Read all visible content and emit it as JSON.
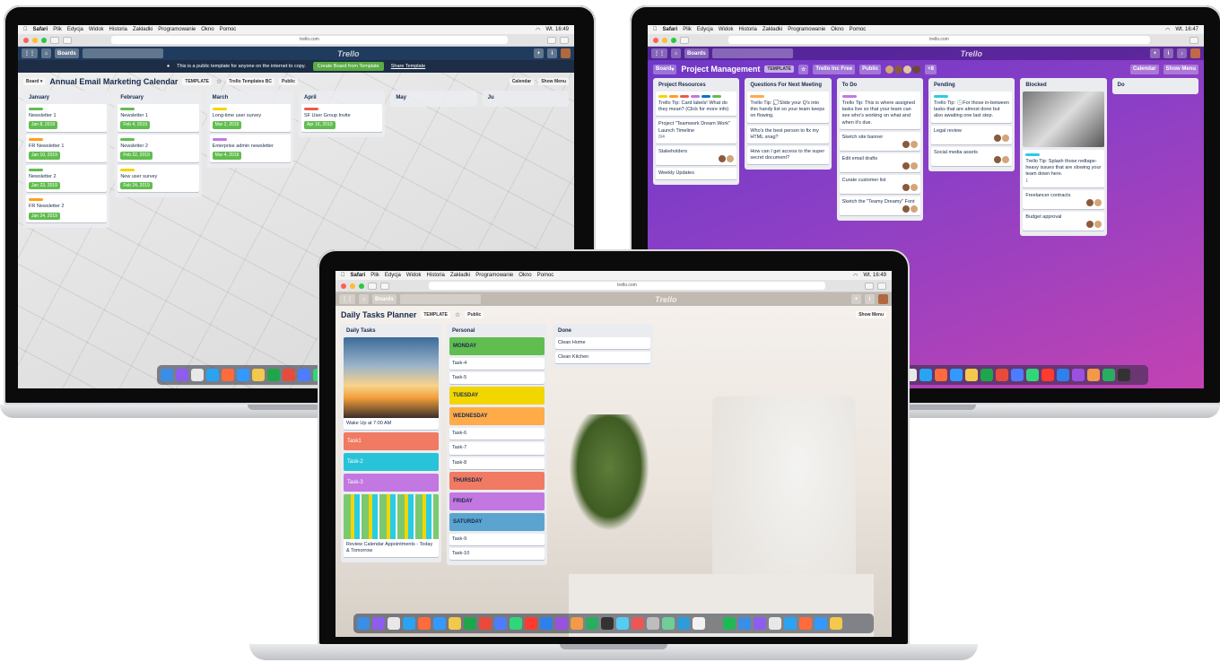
{
  "menubar": {
    "app": "Safari",
    "items": [
      "Plik",
      "Edycja",
      "Widok",
      "Historia",
      "Zakładki",
      "Programowanie",
      "Okno",
      "Pomoc"
    ],
    "time_left": "Wt. 16:49",
    "time_right": "Wt. 16:47",
    "time_mid": "Wt. 16:49"
  },
  "url": "trello.com",
  "boards_label": "Boards",
  "logo": "Trello",
  "left": {
    "public_notice": "This is a public template for anyone on the internet to copy.",
    "create_btn": "Create Board from Template",
    "share_link": "Share Template",
    "board_btn": "Board",
    "title": "Annual Email Marketing Calendar",
    "template_badge": "TEMPLATE",
    "team": "Trello Templates",
    "team_badge": "BC",
    "visibility": "Public",
    "calendar": "Calendar",
    "show_menu": "Show Menu",
    "lists": [
      {
        "name": "January",
        "cards": [
          {
            "t": "Newsletter 1",
            "d": "Jan 8, 2019",
            "c": "#61bd4f"
          },
          {
            "t": "FR Newsletter 1",
            "d": "Jan 10, 2019",
            "c": "#ff9f1a"
          },
          {
            "t": "Newsletter 2",
            "d": "Jan 23, 2019",
            "c": "#61bd4f"
          },
          {
            "t": "FR Newsletter 2",
            "d": "Jan 24, 2019",
            "c": "#ff9f1a"
          }
        ]
      },
      {
        "name": "February",
        "cards": [
          {
            "t": "Newsletter 1",
            "d": "Feb 4, 2019",
            "c": "#61bd4f"
          },
          {
            "t": "Newsletter 2",
            "d": "Feb 22, 2019",
            "c": "#61bd4f"
          },
          {
            "t": "New user survey",
            "d": "Feb 24, 2019",
            "c": "#f2d600"
          }
        ]
      },
      {
        "name": "March",
        "cards": [
          {
            "t": "Long-time user survey",
            "d": "Mar 2, 2019",
            "c": "#f2d600"
          },
          {
            "t": "Enterprise admin newsletter",
            "d": "Mar 4, 2019",
            "c": "#c377e0"
          }
        ]
      },
      {
        "name": "April",
        "cards": [
          {
            "t": "SF User Group Invite",
            "d": "Apr 16, 2019",
            "c": "#eb5a46"
          }
        ]
      },
      {
        "name": "May",
        "cards": []
      },
      {
        "name": "Ju",
        "cards": []
      }
    ]
  },
  "right": {
    "board_btn": "Board",
    "title": "Project Management",
    "template_badge": "TEMPLATE",
    "team": "Trello Inc",
    "team_badge": "Free",
    "visibility": "Public",
    "member_count": "+8",
    "calendar": "Calendar",
    "show_menu": "Show Menu",
    "lists": [
      {
        "name": "Project Resources",
        "cards": [
          "Trello Tip: Card labels! What do they mean? (Click for more info)",
          "Project \"Teamwork Dream Work\" Launch Timeline",
          "Stakeholders",
          "Weekly Updates"
        ],
        "extra": "0/4"
      },
      {
        "name": "Questions For Next Meeting",
        "cards": [
          "Trello Tip: 💭Slide your Q's into this handy list so your team keeps on flowing.",
          "Who's the best person to fix my HTML snag?",
          "How can I get access to the super secret document?"
        ]
      },
      {
        "name": "To Do",
        "cards": [
          "Trello Tip: This is where assigned tasks live so that your team can see who's working on what and when it's due.",
          "Sketch site banner",
          "Edit email drafts",
          "Curate customer list",
          "Sketch the \"Teamy Dreamy\" Font"
        ]
      },
      {
        "name": "Pending",
        "cards": [
          "Trello Tip: 🕒For those in-between tasks that are almost done but also awaiting one last step.",
          "Legal review",
          "Social media assets"
        ]
      },
      {
        "name": "Blocked",
        "cards": [
          "Trello Tip: Splash those redtape-heavy issues that are slowing your team down here.",
          "Freelancer contracts",
          "Budget approval"
        ],
        "count": "1"
      },
      {
        "name": "Do",
        "cards": []
      }
    ]
  },
  "mid": {
    "title": "Daily Tasks Planner",
    "template_badge": "TEMPLATE",
    "visibility": "Public",
    "show_menu": "Show Menu",
    "lists": [
      {
        "name": "Daily Tasks",
        "cards": [
          {
            "t": "Wake Up at 7:00 AM",
            "img": "sunrise"
          },
          {
            "t": "Task1",
            "c": "#f07a62"
          },
          {
            "t": "Task-2",
            "c": "#29c3d9"
          },
          {
            "t": "Task-3",
            "c": "#c377e0"
          },
          {
            "t": "Review Calendar Appointments - Today & Tomorrow",
            "img": "board"
          }
        ]
      },
      {
        "name": "Personal",
        "cards": [
          {
            "t": "MONDAY",
            "c": "#61bd4f"
          },
          {
            "t": "Task-4"
          },
          {
            "t": "Task-5"
          },
          {
            "t": "TUESDAY",
            "c": "#f2d600"
          },
          {
            "t": "WEDNESDAY",
            "c": "#ffab4a"
          },
          {
            "t": "Task-6"
          },
          {
            "t": "Task-7"
          },
          {
            "t": "Task-8"
          },
          {
            "t": "THURSDAY",
            "c": "#f07a62"
          },
          {
            "t": "FRIDAY",
            "c": "#c377e0"
          },
          {
            "t": "SATURDAY",
            "c": "#5ba4cf"
          },
          {
            "t": "Task-9"
          },
          {
            "t": "Task-10"
          }
        ]
      },
      {
        "name": "Done",
        "cards": [
          {
            "t": "Clean Home"
          },
          {
            "t": "Clean Kitchen"
          }
        ]
      }
    ]
  },
  "colors": {
    "trello_blue": "#0079bf",
    "left_header": "#1f3b5e",
    "right_purple": "#7b2fbf",
    "green": "#5aac44"
  }
}
